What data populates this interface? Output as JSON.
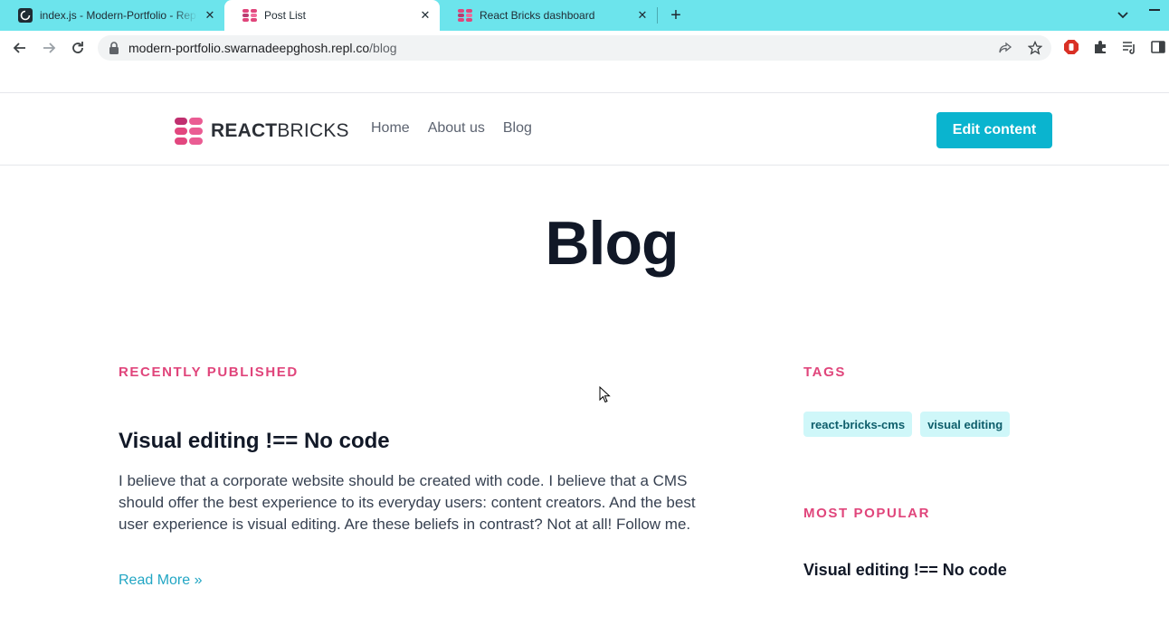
{
  "browser": {
    "tabs": [
      {
        "title": "index.js - Modern-Portfolio - Replit",
        "icon": "replit-icon",
        "active": false
      },
      {
        "title": "Post List",
        "icon": "reactbricks-icon",
        "active": true
      },
      {
        "title": "React Bricks dashboard",
        "icon": "reactbricks-icon",
        "active": false
      }
    ],
    "url_domain": "modern-portfolio.swarnadeepghosh.repl.co",
    "url_path": "/blog",
    "colors": {
      "tabbar": "#6ce4ec"
    }
  },
  "header": {
    "logo_bold": "REACT",
    "logo_light": "BRICKS",
    "nav": [
      "Home",
      "About us",
      "Blog"
    ],
    "edit_button": "Edit content"
  },
  "main": {
    "title": "Blog",
    "recent_label": "RECENTLY PUBLISHED",
    "post": {
      "title": "Visual editing !== No code",
      "excerpt": "I believe that a corporate website should be created with code. I believe that a CMS should offer the best experience to its everyday users: content creators. And the best user experience is visual editing. Are these beliefs in contrast? Not at all! Follow me.",
      "read_more": "Read More  »"
    }
  },
  "sidebar": {
    "tags_label": "TAGS",
    "tags": [
      "react-bricks-cms",
      "visual editing"
    ],
    "popular_label": "MOST POPULAR",
    "popular_post": "Visual editing !== No code"
  },
  "colors": {
    "accent_pink": "#e0457b",
    "accent_cyan": "#0ab4cf",
    "tag_bg": "#cff7f9"
  }
}
